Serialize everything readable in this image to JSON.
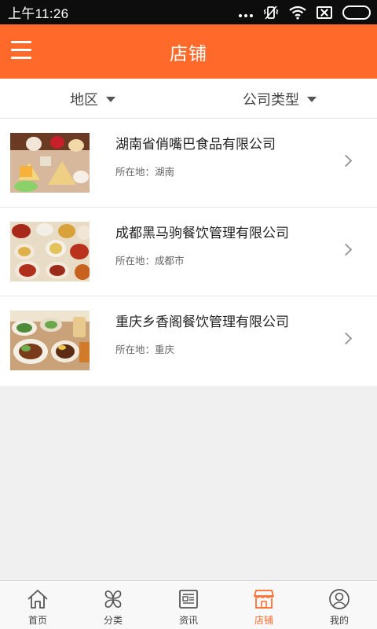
{
  "status": {
    "time": "上午11:26",
    "icons": [
      "more-dots-icon",
      "vibrate-icon",
      "wifi-icon",
      "no-sim-icon",
      "battery-icon"
    ]
  },
  "header": {
    "title": "店铺",
    "menu_icon": "hamburger-menu-icon"
  },
  "filters": [
    {
      "label": "地区",
      "icon": "caret-down-icon"
    },
    {
      "label": "公司类型",
      "icon": "caret-down-icon"
    }
  ],
  "stores": [
    {
      "name": "湖南省俏嘴巴食品有限公司",
      "location": "所在地：湖南"
    },
    {
      "name": "成都黑马驹餐饮管理有限公司",
      "location": "所在地：成都市"
    },
    {
      "name": "重庆乡香阁餐饮管理有限公司",
      "location": "所在地：重庆"
    }
  ],
  "tabs": [
    {
      "label": "首页",
      "icon": "home-icon",
      "active": false
    },
    {
      "label": "分类",
      "icon": "category-icon",
      "active": false
    },
    {
      "label": "资讯",
      "icon": "news-icon",
      "active": false
    },
    {
      "label": "店铺",
      "icon": "store-icon",
      "active": true
    },
    {
      "label": "我的",
      "icon": "user-icon",
      "active": false
    }
  ],
  "colors": {
    "accent": "#ff6a2a",
    "status_bar": "#0d0d0d",
    "background": "#f0f0f0"
  }
}
